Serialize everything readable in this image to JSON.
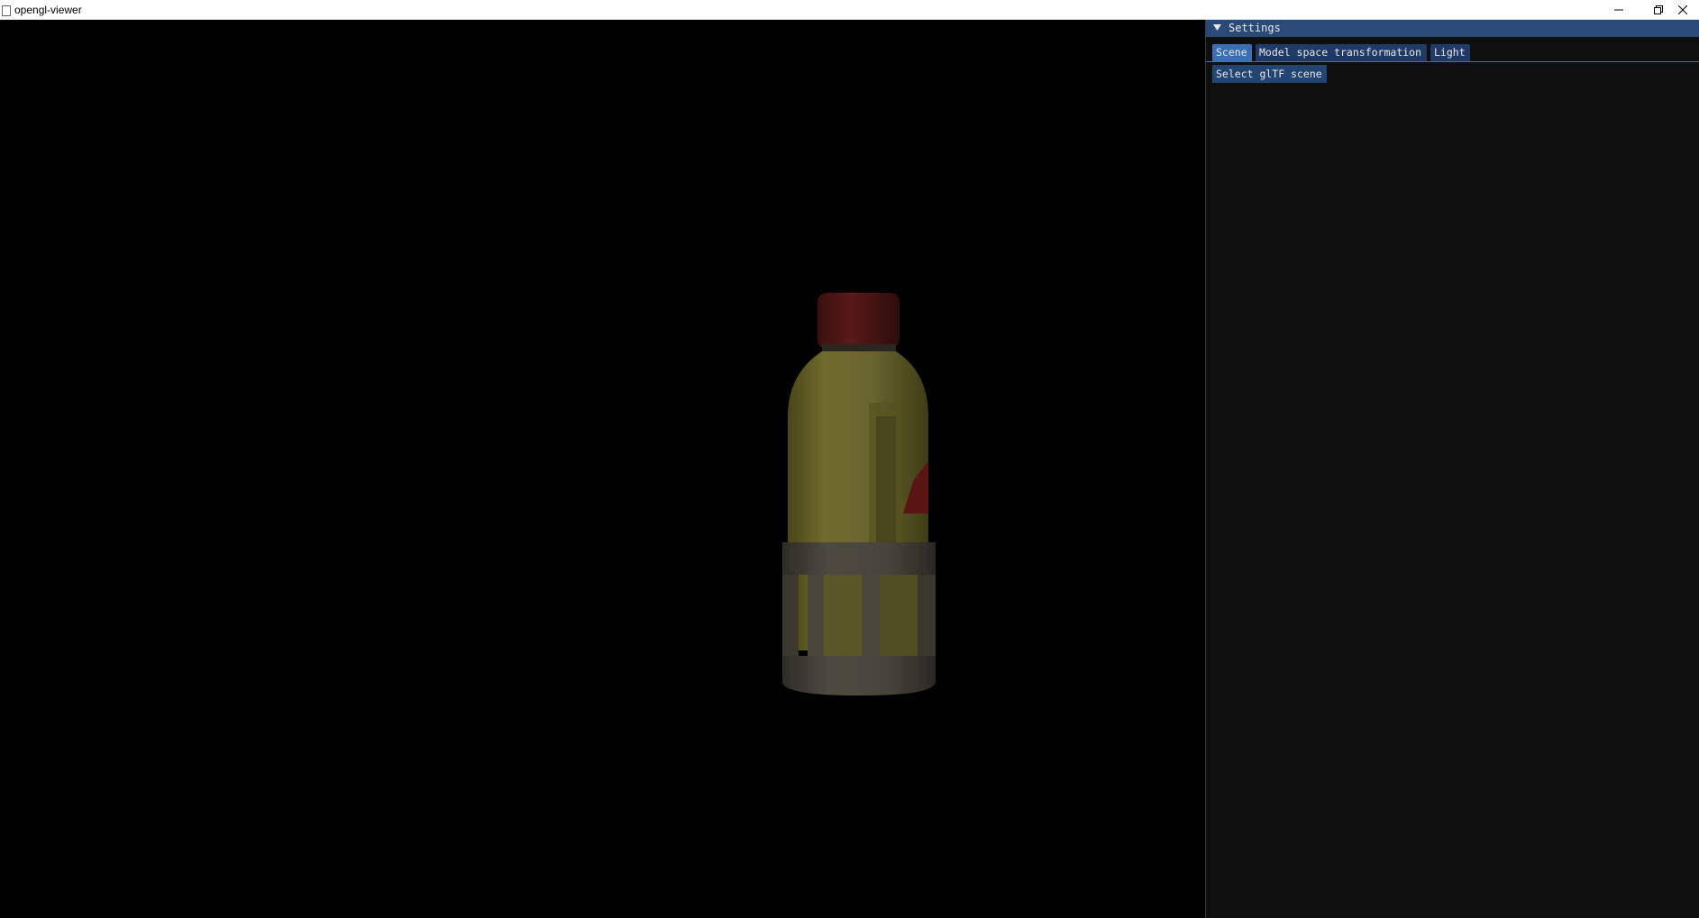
{
  "window": {
    "title": "opengl-viewer",
    "controls": {
      "minimize_icon": "minimize-icon",
      "maximize_icon": "restore-icon",
      "close_icon": "close-icon"
    }
  },
  "viewport": {
    "background": "#000000",
    "model": "bottle"
  },
  "settings_panel": {
    "title": "Settings",
    "collapse_icon": "triangle-down-icon",
    "tabs": [
      {
        "label": "Scene",
        "active": true
      },
      {
        "label": "Model space transformation",
        "active": false
      },
      {
        "label": "Light",
        "active": false
      }
    ],
    "scene": {
      "select_button_label": "Select glTF scene"
    },
    "colors": {
      "header": "#2a4a7a",
      "tab_active": "#3a6fb5",
      "tab_inactive": "#1f3a66",
      "button": "#234574",
      "panel_bg": "#0f0f0f"
    }
  }
}
